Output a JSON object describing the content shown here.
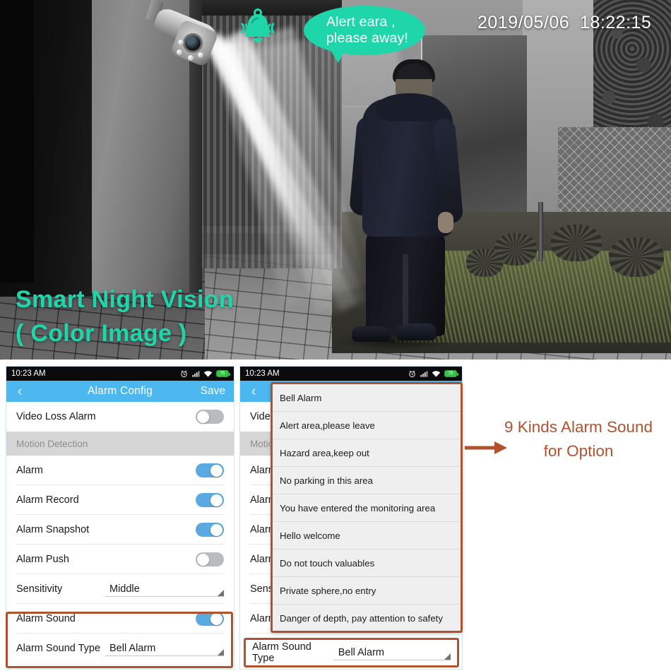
{
  "hero": {
    "bell_icon": "ringing-bell-icon",
    "bubble_text": "Alert eara ,\nplease away!",
    "timestamp": "2019/05/06  18:22:15",
    "caption": "Smart Night Vision\n( Color Image )",
    "accent_color": "#1fd6ab"
  },
  "annotation": {
    "text": "9 Kinds Alarm Sound\nfor Option",
    "color": "#b0522f",
    "arrow_icon": "right-arrow-icon"
  },
  "phone_left": {
    "statusbar": {
      "time": "10:23 AM",
      "icons": [
        "alarm-clock-icon",
        "signal-bars-icon",
        "wifi-icon",
        "battery-icon"
      ],
      "battery_level": "75"
    },
    "navbar": {
      "back_icon": "chevron-left-icon",
      "title": "Alarm Config",
      "save_label": "Save"
    },
    "rows": [
      {
        "label": "Video Loss Alarm",
        "type": "toggle",
        "state": "off"
      },
      {
        "label": "Motion Detection",
        "type": "group"
      },
      {
        "label": "Alarm",
        "type": "toggle",
        "state": "on"
      },
      {
        "label": "Alarm Record",
        "type": "toggle",
        "state": "on"
      },
      {
        "label": "Alarm Snapshot",
        "type": "toggle",
        "state": "on"
      },
      {
        "label": "Alarm Push",
        "type": "toggle",
        "state": "off"
      },
      {
        "label": "Sensitivity",
        "type": "spinner",
        "value": "Middle"
      },
      {
        "label": "Alarm Sound",
        "type": "toggle",
        "state": "on"
      },
      {
        "label": "Alarm Sound Type",
        "type": "spinner",
        "value": "Bell Alarm"
      }
    ]
  },
  "phone_right": {
    "statusbar": {
      "time": "10:23 AM",
      "battery_level": "75"
    },
    "navbar": {
      "back_icon": "chevron-left-icon",
      "title": "",
      "save_label": ""
    },
    "rows": [
      {
        "label": "Video",
        "type": "toggle",
        "state": "off"
      },
      {
        "label": "Motion",
        "type": "group"
      },
      {
        "label": "Alarm",
        "type": "toggle",
        "state": "on"
      },
      {
        "label": "Alarm",
        "type": "toggle",
        "state": "on"
      },
      {
        "label": "Alarm",
        "type": "toggle",
        "state": "on"
      },
      {
        "label": "Alarm",
        "type": "toggle",
        "state": "off"
      },
      {
        "label": "Sensit",
        "type": "spinner",
        "value": ""
      },
      {
        "label": "Alarm",
        "type": "toggle",
        "state": "on"
      }
    ],
    "dropdown": {
      "options": [
        "Bell Alarm",
        "Alert area,please leave",
        "Hazard area,keep out",
        "No parking in this area",
        "You have entered the monitoring area",
        "Hello welcome",
        "Do not touch valuables",
        "Private sphere,no entry",
        "Danger of depth, pay attention to safety"
      ]
    },
    "bottom_row": {
      "label": "Alarm Sound Type",
      "value": "Bell Alarm"
    }
  }
}
